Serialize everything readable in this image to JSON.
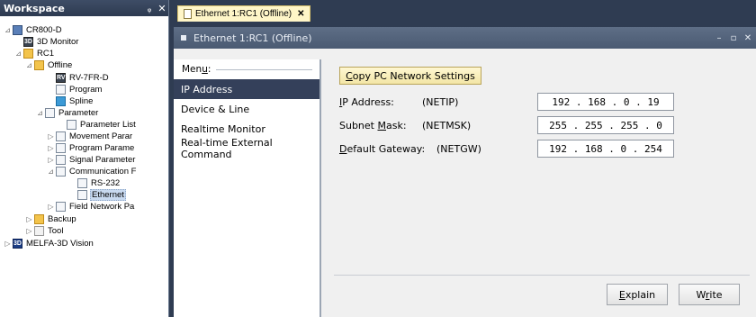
{
  "workspace": {
    "title": "Workspace",
    "pin_glyph": "ᵩ",
    "close_glyph": "✕",
    "tree": [
      {
        "label": "CR800-D",
        "icon": "controller-icon",
        "glyph": "",
        "expander": "⊿",
        "selected": false
      },
      {
        "label": "3D Monitor",
        "icon": "3d-monitor-icon",
        "glyph": "3D",
        "expander": "",
        "selected": false
      },
      {
        "label": "RC1",
        "icon": "robot-folder-icon",
        "glyph": "",
        "expander": "⊿",
        "selected": false
      },
      {
        "label": "Offline",
        "icon": "offline-folder-icon",
        "glyph": "",
        "expander": "⊿",
        "selected": false
      },
      {
        "label": "RV-7FR-D",
        "icon": "robot-model-icon",
        "glyph": "RV",
        "expander": "",
        "selected": false
      },
      {
        "label": "Program",
        "icon": "program-icon",
        "glyph": "",
        "expander": "",
        "selected": false
      },
      {
        "label": "Spline",
        "icon": "spline-icon",
        "glyph": "",
        "expander": "",
        "selected": false
      },
      {
        "label": "Parameter",
        "icon": "parameter-icon",
        "glyph": "",
        "expander": "⊿",
        "selected": false
      },
      {
        "label": "Parameter List",
        "icon": "parameter-list-icon",
        "glyph": "",
        "expander": "",
        "selected": false
      },
      {
        "label": "Movement Parar",
        "icon": "movement-param-icon",
        "glyph": "",
        "expander": "▷",
        "selected": false
      },
      {
        "label": "Program Parame",
        "icon": "program-param-icon",
        "glyph": "",
        "expander": "▷",
        "selected": false
      },
      {
        "label": "Signal Parameter",
        "icon": "signal-param-icon",
        "glyph": "",
        "expander": "▷",
        "selected": false
      },
      {
        "label": "Communication F",
        "icon": "communication-param-icon",
        "glyph": "",
        "expander": "⊿",
        "selected": false
      },
      {
        "label": "RS-232",
        "icon": "rs232-icon",
        "glyph": "",
        "expander": "",
        "selected": false
      },
      {
        "label": "Ethernet",
        "icon": "ethernet-icon",
        "glyph": "",
        "expander": "",
        "selected": true
      },
      {
        "label": "Field Network Pa",
        "icon": "field-network-icon",
        "glyph": "",
        "expander": "▷",
        "selected": false
      },
      {
        "label": "Backup",
        "icon": "backup-icon",
        "glyph": "",
        "expander": "▷",
        "selected": false
      },
      {
        "label": "Tool",
        "icon": "tool-icon",
        "glyph": "",
        "expander": "▷",
        "selected": false
      },
      {
        "label": "MELFA-3D Vision",
        "icon": "3d-vision-icon",
        "glyph": "3D",
        "expander": "▷",
        "selected": false
      }
    ]
  },
  "doc_tab": {
    "label": "Ethernet 1:RC1 (Offline)",
    "close_glyph": "✕"
  },
  "doc_window": {
    "title": "Ethernet 1:RC1 (Offline)",
    "minimize_glyph": "–",
    "maximize_glyph": "▫",
    "close_glyph": "✕"
  },
  "menu": {
    "title_pre": "Men",
    "title_ul": "u",
    "title_post": ":",
    "items": [
      {
        "label": "IP Address",
        "active": true
      },
      {
        "label": "Device & Line",
        "active": false
      },
      {
        "label": "Realtime Monitor",
        "active": false
      },
      {
        "label": "Real-time External Command",
        "active": false
      }
    ]
  },
  "settings": {
    "copy_button": {
      "pre": "",
      "ul": "C",
      "post": "opy PC Network Settings"
    },
    "fields": [
      {
        "label_pre": "",
        "label_ul": "I",
        "label_post": "P Address:",
        "param": "(NETIP)",
        "value": "192 . 168 .  0  .  19"
      },
      {
        "label_pre": "Subnet ",
        "label_ul": "M",
        "label_post": "ask:",
        "param": "(NETMSK)",
        "value": "255 . 255 . 255 .  0"
      },
      {
        "label_pre": "",
        "label_ul": "D",
        "label_post": "efault Gateway:",
        "param": "(NETGW)",
        "value": "192 . 168 .  0  . 254"
      }
    ],
    "explain_button": {
      "pre": "",
      "ul": "E",
      "post": "xplain"
    },
    "write_button": {
      "pre": "W",
      "ul": "r",
      "post": "ite"
    }
  },
  "colors": {
    "frame_dark": "#2f3c52",
    "menu_active": "#34405a",
    "tab_highlight": "#fff6c8"
  }
}
